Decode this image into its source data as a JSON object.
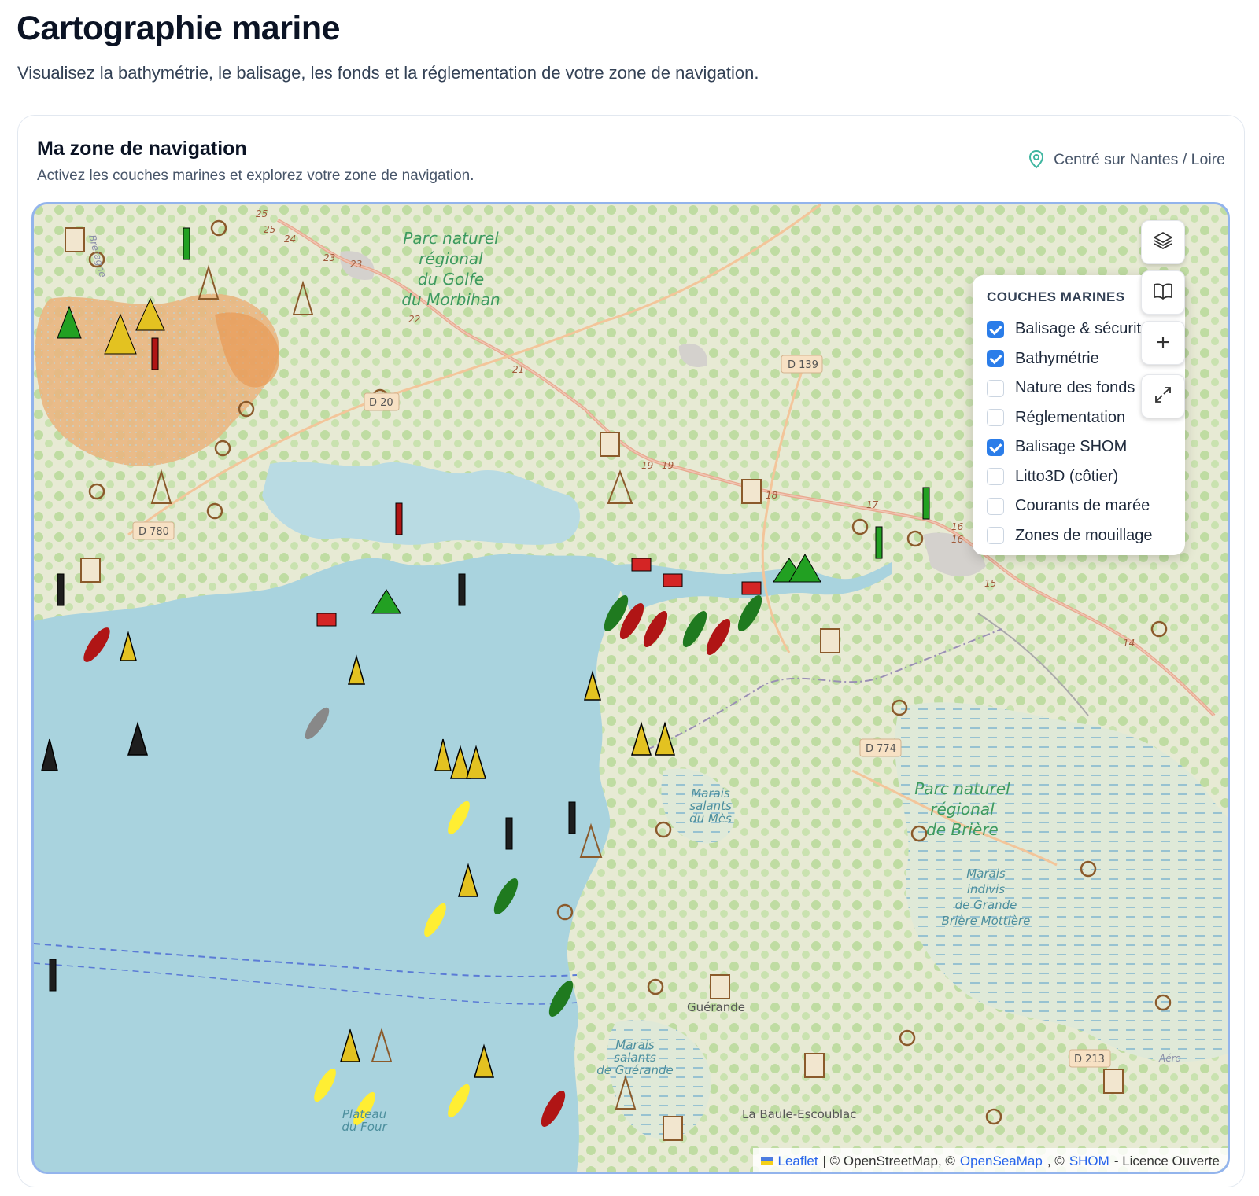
{
  "header": {
    "title": "Cartographie marine",
    "subtitle": "Visualisez la bathymétrie, le balisage, les fonds et la réglementation de votre zone de navigation."
  },
  "card": {
    "title": "Ma zone de navigation",
    "subtitle": "Activez les couches marines et explorez votre zone de navigation.",
    "center_label": "Centré sur Nantes / Loire"
  },
  "map": {
    "layers_panel": {
      "title": "COUCHES MARINES",
      "layers": [
        {
          "label": "Balisage & sécurité",
          "checked": true
        },
        {
          "label": "Bathymétrie",
          "checked": true
        },
        {
          "label": "Nature des fonds",
          "checked": false
        },
        {
          "label": "Réglementation",
          "checked": false
        },
        {
          "label": "Balisage SHOM",
          "checked": true
        },
        {
          "label": "Litto3D (côtier)",
          "checked": false
        },
        {
          "label": "Courants de marée",
          "checked": false
        },
        {
          "label": "Zones de mouillage",
          "checked": false
        }
      ]
    },
    "controls": {
      "layers_icon": "layers-icon",
      "book_icon": "book-icon",
      "zoom_in_label": "+",
      "fullscreen_icon": "expand-icon"
    },
    "labels": {
      "pnr_morbihan": [
        "Parc naturel",
        "régional",
        "du Golfe",
        "du Morbihan"
      ],
      "pnr_briere": [
        "Parc naturel",
        "régional",
        "de Brière"
      ],
      "marais_indivis": [
        "Marais",
        "indivis",
        "de Grande",
        "Brière Mottière"
      ],
      "marais_mes": [
        "Marais",
        "salants",
        "du Mès"
      ],
      "marais_guerande": [
        "Marais",
        "salants",
        "de Guérande"
      ],
      "plateau": [
        "Plateau",
        "du Four"
      ],
      "guerande": "Guérande",
      "escoublac": "La Baule-Escoublac",
      "roads": [
        "D 139",
        "D 20",
        "D 780",
        "D 774",
        "D 213"
      ],
      "route_numbers": [
        "25",
        "25",
        "24",
        "23",
        "23",
        "22",
        "21",
        "19",
        "19",
        "18",
        "17",
        "16",
        "16",
        "15",
        "14"
      ],
      "side_labels": [
        "Bretagne",
        "Aéro"
      ]
    },
    "attribution": {
      "leaflet": "Leaflet",
      "sep1": "| © OpenStreetMap, ©",
      "openseamap": "OpenSeaMap",
      "sep2": ", ©",
      "shom": "SHOM",
      "license": "- Licence Ouverte"
    },
    "colors": {
      "sea": "#a9d3de",
      "land": "#e9ead8",
      "forest": "#b7d89a",
      "frame_border": "#93b4ec",
      "checkbox_on": "#2b7de9"
    }
  }
}
